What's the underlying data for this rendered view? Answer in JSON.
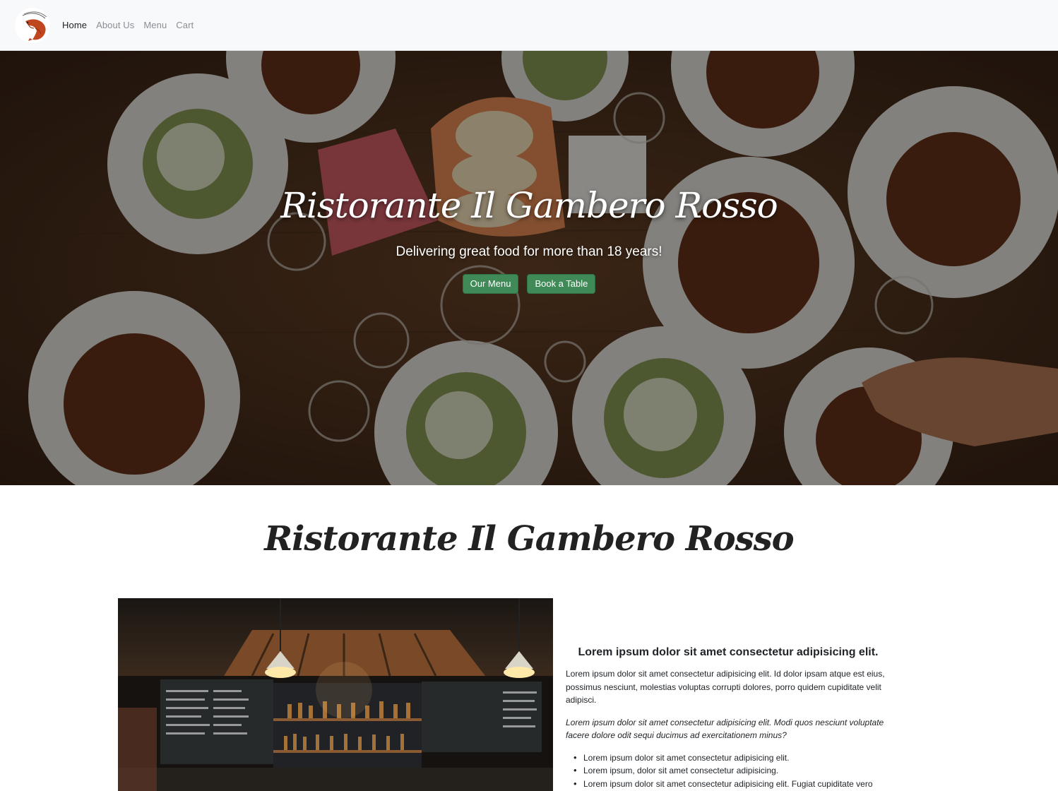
{
  "nav": {
    "logo_icon": "shrimp-logo-icon",
    "links": [
      {
        "label": "Home",
        "active": true
      },
      {
        "label": "About Us",
        "active": false
      },
      {
        "label": "Menu",
        "active": false
      },
      {
        "label": "Cart",
        "active": false
      }
    ]
  },
  "hero": {
    "title": "Ristorante Il Gambero Rosso",
    "subtitle": "Delivering great food for more than 18 years!",
    "btn_menu": "Our Menu",
    "btn_book": "Book a Table"
  },
  "about": {
    "title": "Ristorante Il Gambero Rosso",
    "heading": "Lorem ipsum dolor sit amet consectetur adipisicing elit.",
    "paragraph": "Lorem ipsum dolor sit amet consectetur adipisicing elit. Id dolor ipsam atque est eius, possimus nesciunt, molestias voluptas corrupti dolores, porro quidem cupiditate velit adipisci.",
    "italic_paragraph": "Lorem ipsum dolor sit amet consectetur adipisicing elit. Modi quos nesciunt voluptate facere dolore odit sequi ducimus ad exercitationem minus?",
    "list": [
      "Lorem ipsum dolor sit amet consectetur adipisicing elit.",
      "Lorem ipsum, dolor sit amet consectetur adipisicing.",
      "Lorem ipsum dolor sit amet consectetur adipisicing elit. Fugiat cupiditate vero"
    ]
  },
  "colors": {
    "button": "#3f8a56",
    "navbar_bg": "#f8f9fa",
    "logo_accent": "#c0461f"
  }
}
